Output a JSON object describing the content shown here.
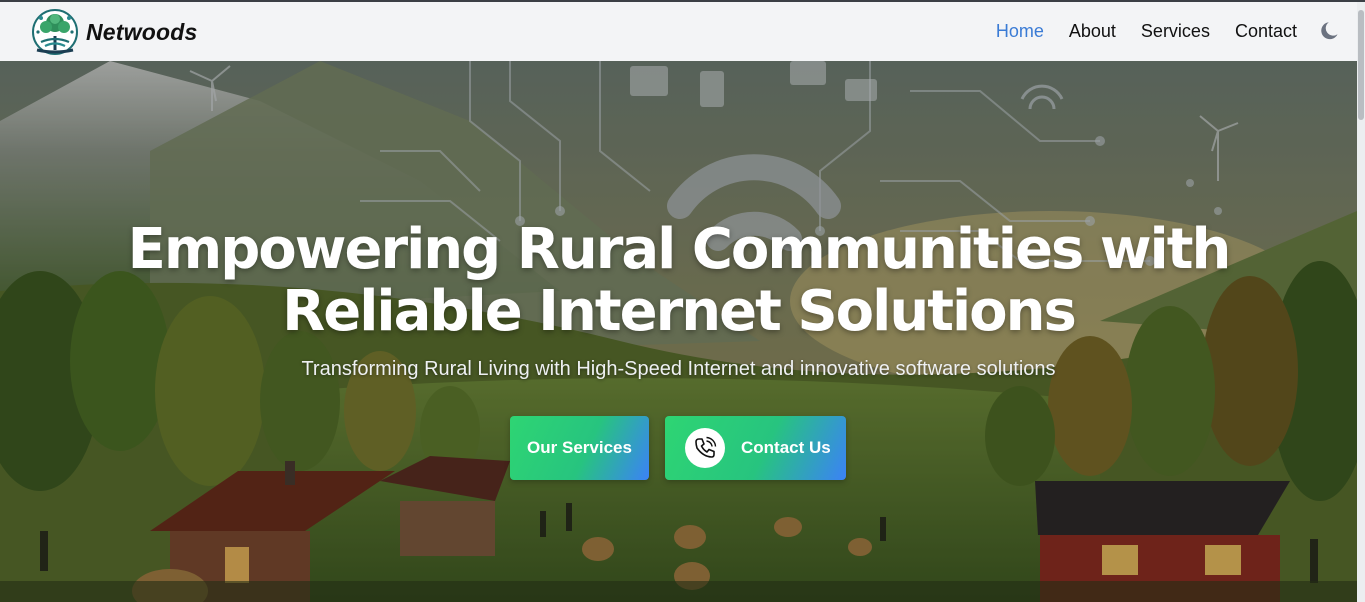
{
  "brand": {
    "name": "Netwoods",
    "logo_icon": "tree-wifi-logo-icon"
  },
  "nav": {
    "items": [
      {
        "label": "Home",
        "active": true
      },
      {
        "label": "About",
        "active": false
      },
      {
        "label": "Services",
        "active": false
      },
      {
        "label": "Contact",
        "active": false
      }
    ],
    "theme_toggle_icon": "moon-icon"
  },
  "hero": {
    "title": "Empowering Rural Communities with Reliable Internet Solutions",
    "subtitle": "Transforming Rural Living with High-Speed Internet and innovative software solutions",
    "buttons": {
      "services_label": "Our Services",
      "contact_label": "Contact Us",
      "contact_icon": "phone-icon"
    }
  },
  "colors": {
    "nav_active": "#3a7bd5",
    "nav_bg": "#f3f4f6",
    "button_gradient_start": "#2ed573",
    "button_gradient_end": "#3b82f6"
  }
}
